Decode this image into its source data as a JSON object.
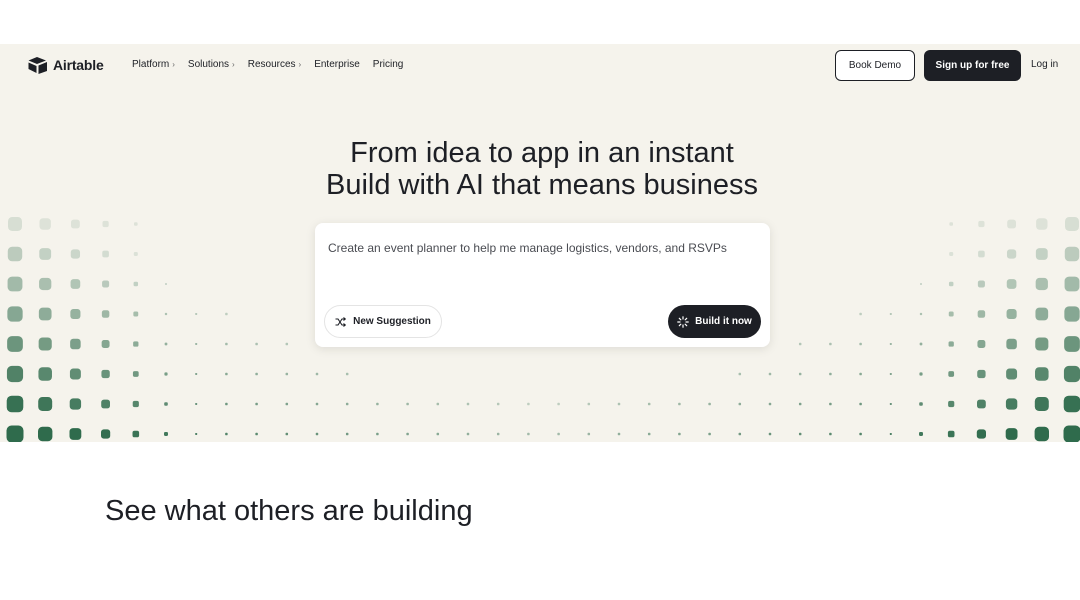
{
  "brand": {
    "name": "Airtable",
    "icon": "airtable-logo-icon"
  },
  "nav": {
    "links": [
      {
        "label": "Platform",
        "has_menu": true
      },
      {
        "label": "Solutions",
        "has_menu": true
      },
      {
        "label": "Resources",
        "has_menu": true
      },
      {
        "label": "Enterprise",
        "has_menu": false
      },
      {
        "label": "Pricing",
        "has_menu": false
      }
    ],
    "book_demo": "Book Demo",
    "signup": "Sign up for free",
    "login": "Log in"
  },
  "hero": {
    "line1": "From idea to app in an instant",
    "line2": "Build with AI that means business"
  },
  "prompt": {
    "text": "Create an event planner to help me manage logistics, vendors, and RSVPs",
    "suggestion_label": "New Suggestion",
    "suggestion_icon": "shuffle-icon",
    "build_label": "Build it now",
    "build_icon": "loader-icon"
  },
  "showcase": {
    "title": "See what others are building"
  },
  "colors": {
    "accent_dark": "#1d1f25",
    "hero_bg": "#f5f3ec",
    "dot_green": "#2f6b4c"
  }
}
